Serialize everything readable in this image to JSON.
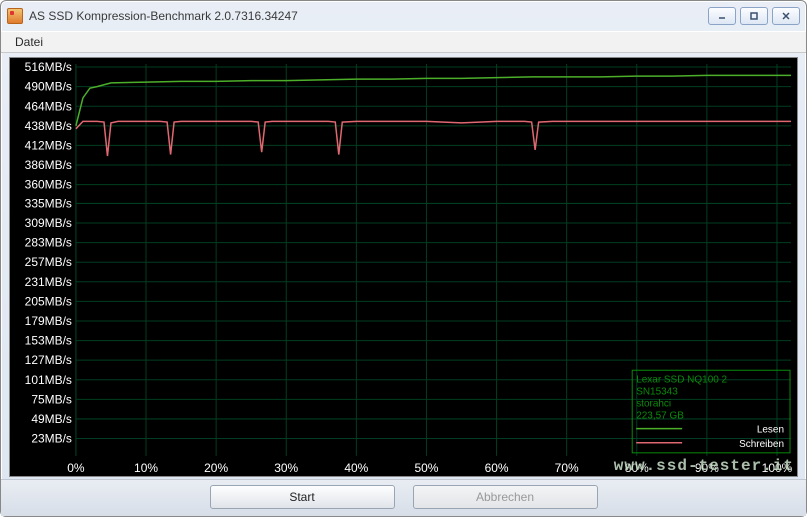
{
  "window": {
    "title": "AS SSD Kompression-Benchmark 2.0.7316.34247"
  },
  "menu": {
    "file": "Datei"
  },
  "buttons": {
    "start": "Start",
    "cancel": "Abbrechen"
  },
  "legend": {
    "device": "Lexar SSD NQ100 2",
    "serial": "SN15343",
    "driver": "storahci",
    "capacity": "223,57 GB",
    "read": "Lesen",
    "write": "Schreiben"
  },
  "watermark": "www.ssd-tester.it",
  "chart_data": {
    "type": "line",
    "title": "",
    "xlabel": "",
    "ylabel": "",
    "x_unit": "%",
    "y_unit": "MB/s",
    "y_ticks": [
      23,
      49,
      75,
      101,
      127,
      153,
      179,
      205,
      231,
      257,
      283,
      309,
      335,
      360,
      386,
      412,
      438,
      464,
      490,
      516
    ],
    "y_tick_labels": [
      "23MB/s",
      "49MB/s",
      "75MB/s",
      "101MB/s",
      "127MB/s",
      "153MB/s",
      "179MB/s",
      "205MB/s",
      "231MB/s",
      "257MB/s",
      "283MB/s",
      "309MB/s",
      "335MB/s",
      "360MB/s",
      "386MB/s",
      "412MB/s",
      "438MB/s",
      "464MB/s",
      "490MB/s",
      "516MB/s"
    ],
    "x_ticks": [
      0,
      10,
      20,
      30,
      40,
      50,
      60,
      70,
      80,
      90,
      100
    ],
    "x_tick_labels": [
      "0%",
      "10%",
      "20%",
      "30%",
      "40%",
      "50%",
      "60%",
      "70%",
      "80%",
      "90%",
      "100%"
    ],
    "xlim": [
      0,
      102
    ],
    "ylim": [
      0,
      520
    ],
    "series": [
      {
        "name": "Lesen",
        "color": "#4caf2a",
        "x": [
          0,
          1,
          2,
          3,
          5,
          10,
          15,
          20,
          25,
          30,
          35,
          40,
          45,
          50,
          55,
          60,
          65,
          70,
          75,
          80,
          85,
          90,
          95,
          100,
          102
        ],
        "y": [
          438,
          475,
          488,
          490,
          495,
          496,
          497,
          497,
          498,
          498,
          499,
          500,
          500,
          501,
          501,
          502,
          503,
          503,
          503,
          504,
          504,
          505,
          505,
          505,
          505
        ]
      },
      {
        "name": "Schreiben",
        "color": "#e06871",
        "x": [
          0,
          1,
          3,
          4,
          4.5,
          5,
          6,
          8,
          10,
          12,
          13,
          13.5,
          14,
          15,
          18,
          22,
          25,
          26,
          26.5,
          27,
          28,
          32,
          36,
          37,
          37.5,
          38,
          40,
          45,
          50,
          55,
          60,
          64,
          65,
          65.5,
          66,
          68,
          75,
          80,
          85,
          90,
          95,
          100,
          102
        ],
        "y": [
          434,
          444,
          444,
          443,
          398,
          442,
          444,
          444,
          444,
          444,
          443,
          400,
          443,
          444,
          444,
          444,
          444,
          443,
          403,
          443,
          444,
          444,
          444,
          443,
          400,
          443,
          444,
          444,
          444,
          442,
          444,
          444,
          443,
          406,
          443,
          444,
          444,
          444,
          444,
          444,
          444,
          444,
          444
        ]
      }
    ]
  }
}
